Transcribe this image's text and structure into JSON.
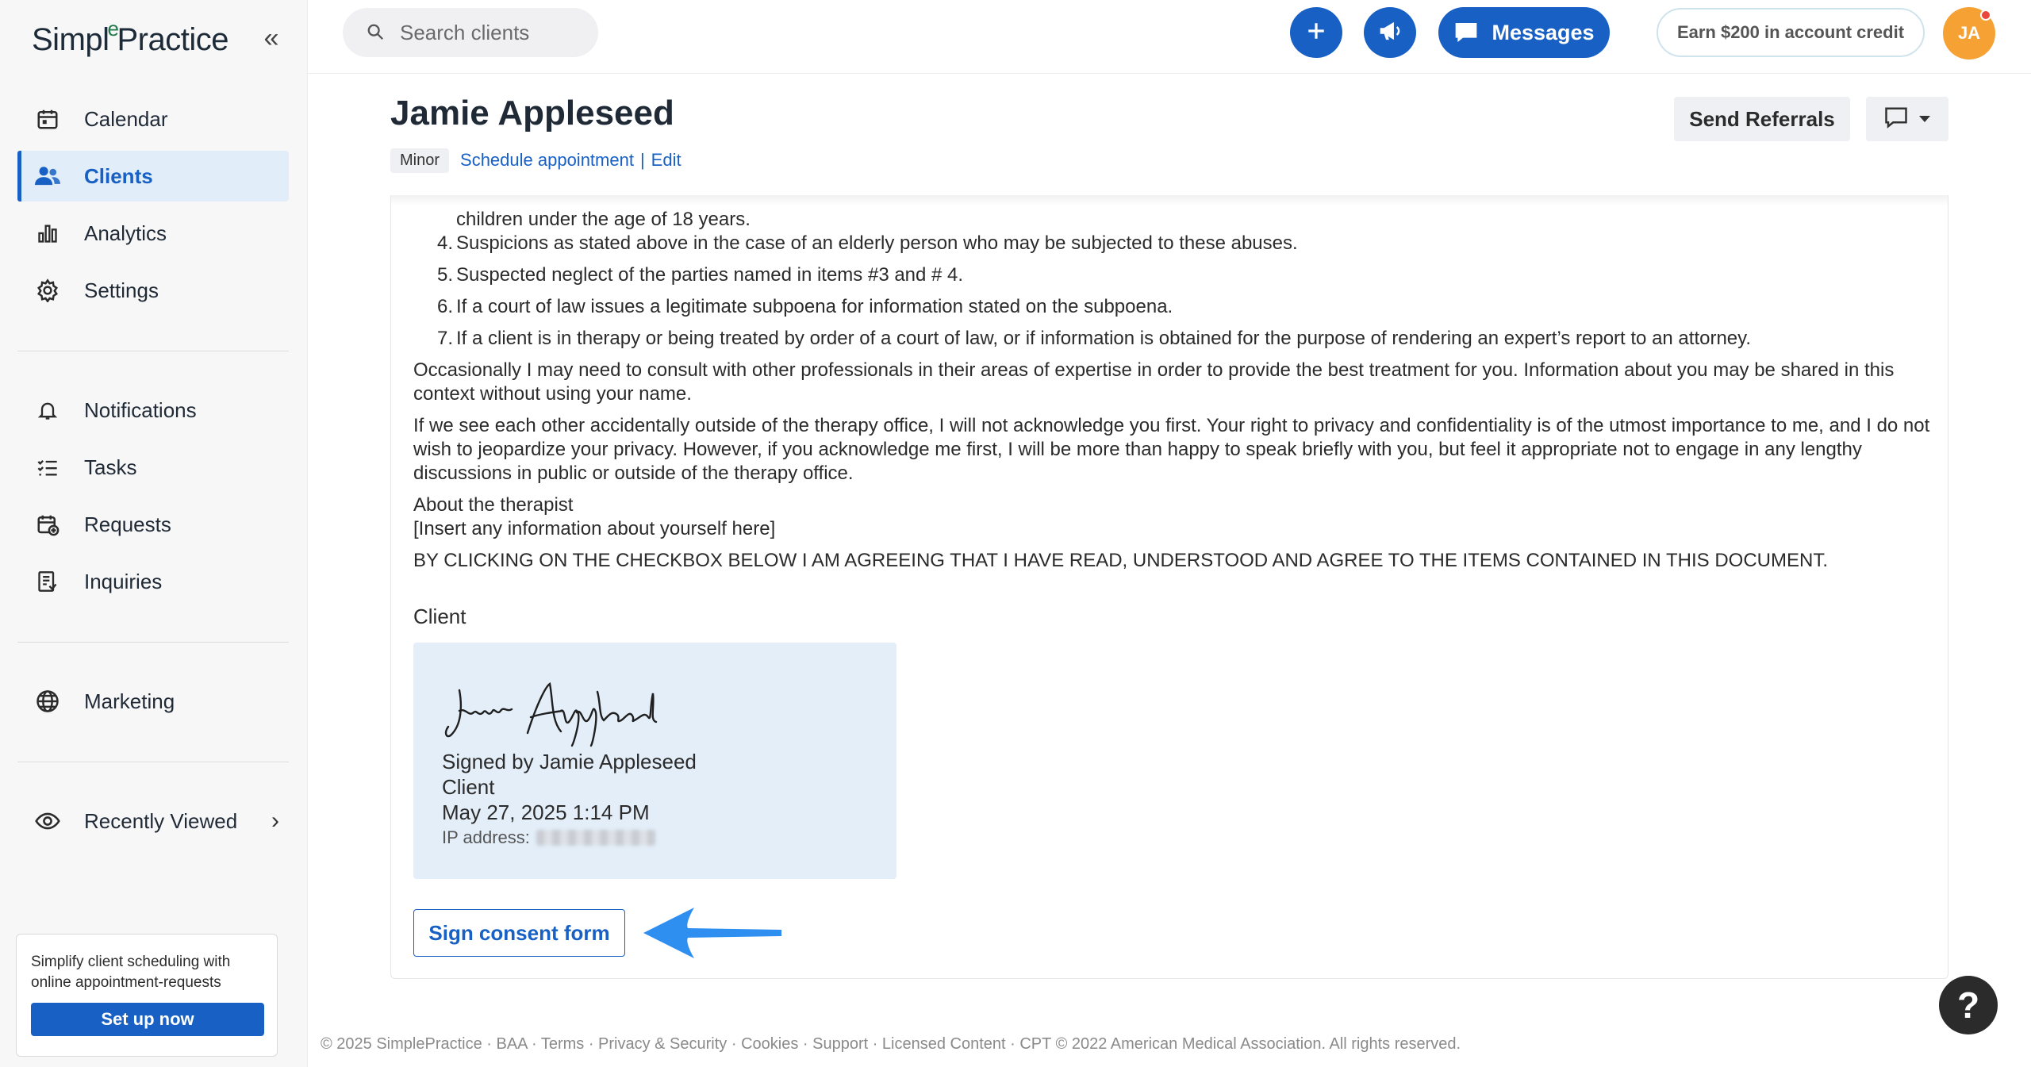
{
  "brand": {
    "name_part1": "Simpl",
    "name_part2": "Practice",
    "leaf": "e"
  },
  "sidebar": {
    "collapse_icon": "double-chevron-left-icon",
    "items": [
      {
        "label": "Calendar",
        "icon": "calendar-icon",
        "active": false
      },
      {
        "label": "Clients",
        "icon": "users-icon",
        "active": true
      },
      {
        "label": "Analytics",
        "icon": "bar-chart-icon",
        "active": false
      },
      {
        "label": "Settings",
        "icon": "gear-icon",
        "active": false
      },
      {
        "label": "Notifications",
        "icon": "bell-icon",
        "active": false
      },
      {
        "label": "Tasks",
        "icon": "checklist-icon",
        "active": false
      },
      {
        "label": "Requests",
        "icon": "calendar-plus-icon",
        "active": false
      },
      {
        "label": "Inquiries",
        "icon": "document-list-icon",
        "active": false
      },
      {
        "label": "Marketing",
        "icon": "globe-icon",
        "active": false
      },
      {
        "label": "Recently Viewed",
        "icon": "eye-icon",
        "active": false
      }
    ],
    "promo": {
      "text": "Simplify client scheduling with online appointment-requests",
      "button": "Set up now"
    }
  },
  "topbar": {
    "search_placeholder": "Search clients",
    "messages_label": "Messages",
    "earn_label": "Earn $200 in account credit",
    "avatar_initials": "JA"
  },
  "header": {
    "client_name": "Jamie Appleseed",
    "badge": "Minor",
    "schedule_link": "Schedule appointment",
    "separator": "|",
    "edit_link": "Edit",
    "send_referrals": "Send Referrals"
  },
  "document": {
    "cut_line": "children under the age of 18 years.",
    "list": [
      {
        "num": "4.",
        "text": "Suspicions as stated above in the case of an elderly person who may be subjected to these abuses."
      },
      {
        "num": "5.",
        "text": "Suspected neglect of the parties named in items #3 and # 4."
      },
      {
        "num": "6.",
        "text": "If a court of law issues a legitimate subpoena for information stated on the subpoena."
      },
      {
        "num": "7.",
        "text": "If a client is in therapy or being treated by order of a court of law, or if information is obtained for the purpose of rendering an expert’s report to an attorney."
      }
    ],
    "para1": "Occasionally I may need to consult with other professionals in their areas of expertise in order to provide the best treatment for you. Information about you may be shared in this context without using your name.",
    "para2": "If we see each other accidentally outside of the therapy office, I will not acknowledge you first. Your right to privacy and confidentiality is of the utmost importance to me, and I do not wish to jeopardize your privacy. However, if you acknowledge me first, I will be more than happy to speak briefly with you, but feel it appropriate not to engage in any lengthy discussions in public or outside of the therapy office.",
    "about_title": "About the therapist",
    "about_body": "[Insert any information about yourself here]",
    "agreement": "BY CLICKING ON THE CHECKBOX BELOW I AM AGREEING THAT I HAVE READ, UNDERSTOOD AND AGREE TO THE ITEMS CONTAINED IN THIS DOCUMENT.",
    "client_label": "Client",
    "signature": {
      "script_name": "Jamie Appleseed",
      "signed_by": "Signed by Jamie Appleseed",
      "role": "Client",
      "date": "May 27, 2025 1:14 PM",
      "ip_label": "IP address:"
    },
    "sign_button": "Sign consent form"
  },
  "footer": {
    "text": "© 2025 SimplePractice · BAA · Terms · Privacy & Security · Cookies · Support · Licensed Content · CPT © 2022 American Medical Association. All rights reserved."
  },
  "help_label": "?",
  "colors": {
    "accent": "#1860c4",
    "avatar": "#f6a133",
    "arrow": "#2f8ff0",
    "signature_bg": "#e3eef9"
  }
}
